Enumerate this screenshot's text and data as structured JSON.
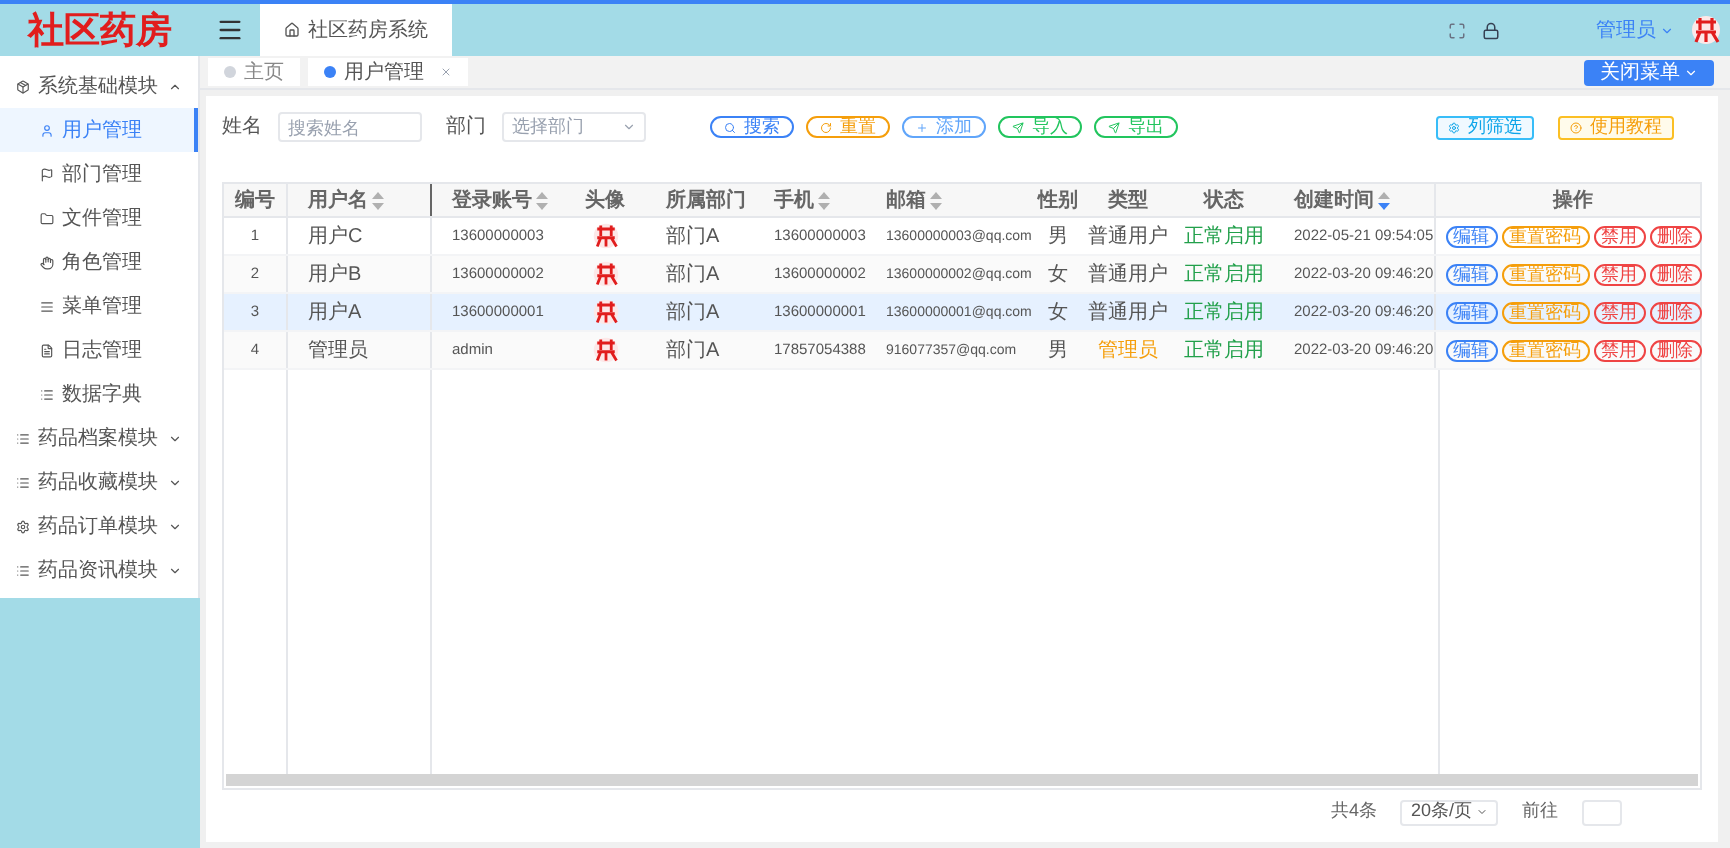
{
  "logo": "社区药房",
  "breadcrumb": "社区药房系统",
  "user": {
    "name": "管理员"
  },
  "tabs": [
    {
      "label": "主页",
      "selected": false,
      "closable": false
    },
    {
      "label": "用户管理",
      "selected": true,
      "closable": true
    }
  ],
  "close_menu": "关闭菜单",
  "sidebar": {
    "items": [
      {
        "label": "系统基础模块",
        "expanded": true,
        "children": [
          {
            "label": "用户管理",
            "selected": true
          },
          {
            "label": "部门管理",
            "selected": false
          },
          {
            "label": "文件管理",
            "selected": false
          },
          {
            "label": "角色管理",
            "selected": false
          },
          {
            "label": "菜单管理",
            "selected": false
          },
          {
            "label": "日志管理",
            "selected": false
          },
          {
            "label": "数据字典",
            "selected": false
          }
        ]
      },
      {
        "label": "药品档案模块",
        "expanded": false
      },
      {
        "label": "药品收藏模块",
        "expanded": false
      },
      {
        "label": "药品订单模块",
        "expanded": false
      },
      {
        "label": "药品资讯模块",
        "expanded": false
      }
    ]
  },
  "filters": [
    {
      "label": "姓名",
      "placeholder": "搜索姓名",
      "kind": "text"
    },
    {
      "label": "部门",
      "placeholder": "选择部门",
      "kind": "select"
    }
  ],
  "toolbar": [
    {
      "label": "搜索",
      "kind": "search"
    },
    {
      "label": "重置",
      "kind": "reset"
    },
    {
      "label": "添加",
      "kind": "add"
    },
    {
      "label": "导入",
      "kind": "import"
    },
    {
      "label": "导出",
      "kind": "export"
    }
  ],
  "tools": [
    {
      "label": "列筛选",
      "kind": "columns"
    },
    {
      "label": "使用教程",
      "kind": "help"
    }
  ],
  "table": {
    "columns": [
      {
        "label": "编号",
        "sortable": false,
        "sorted": false
      },
      {
        "label": "用户名",
        "sortable": true,
        "sorted": false
      },
      {
        "label": "登录账号",
        "sortable": true,
        "sorted": false
      },
      {
        "label": "头像",
        "sortable": false,
        "sorted": false
      },
      {
        "label": "所属部门",
        "sortable": false,
        "sorted": false
      },
      {
        "label": "手机",
        "sortable": true,
        "sorted": false
      },
      {
        "label": "邮箱",
        "sortable": true,
        "sorted": false
      },
      {
        "label": "性别",
        "sortable": false,
        "sorted": false
      },
      {
        "label": "类型",
        "sortable": false,
        "sorted": false
      },
      {
        "label": "状态",
        "sortable": false,
        "sorted": false
      },
      {
        "label": "创建时间",
        "sortable": true,
        "sorted": true
      },
      {
        "label": "操作",
        "sortable": false,
        "sorted": false
      }
    ],
    "rows": [
      {
        "id": "1",
        "name": "用户C",
        "account": "13600000003",
        "dept": "部门A",
        "phone": "13600000003",
        "email": "13600000003@qq.com",
        "gender": "男",
        "type": "普通用户",
        "kind": "normal",
        "status": "正常启用",
        "created": "2022-05-21 09:54:05",
        "selected": false,
        "actions": [
          {
            "label": "编辑",
            "kind": "edit"
          },
          {
            "label": "重置密码",
            "kind": "reset"
          },
          {
            "label": "禁用",
            "kind": "danger"
          },
          {
            "label": "删除",
            "kind": "danger"
          }
        ]
      },
      {
        "id": "2",
        "name": "用户B",
        "account": "13600000002",
        "dept": "部门A",
        "phone": "13600000002",
        "email": "13600000002@qq.com",
        "gender": "女",
        "type": "普通用户",
        "kind": "normal",
        "status": "正常启用",
        "created": "2022-03-20 09:46:20",
        "selected": false,
        "actions": [
          {
            "label": "编辑",
            "kind": "edit"
          },
          {
            "label": "重置密码",
            "kind": "reset"
          },
          {
            "label": "禁用",
            "kind": "danger"
          },
          {
            "label": "删除",
            "kind": "danger"
          }
        ]
      },
      {
        "id": "3",
        "name": "用户A",
        "account": "13600000001",
        "dept": "部门A",
        "phone": "13600000001",
        "email": "13600000001@qq.com",
        "gender": "女",
        "type": "普通用户",
        "kind": "normal",
        "status": "正常启用",
        "created": "2022-03-20 09:46:20",
        "selected": true,
        "actions": [
          {
            "label": "编辑",
            "kind": "edit"
          },
          {
            "label": "重置密码",
            "kind": "reset"
          },
          {
            "label": "禁用",
            "kind": "danger"
          },
          {
            "label": "删除",
            "kind": "danger"
          }
        ]
      },
      {
        "id": "4",
        "name": "管理员",
        "account": "admin",
        "dept": "部门A",
        "phone": "17857054388",
        "email": "916077357@qq.com",
        "gender": "男",
        "type": "管理员",
        "kind": "admin",
        "status": "正常启用",
        "created": "2022-03-20 09:46:20",
        "selected": false,
        "actions": [
          {
            "label": "编辑",
            "kind": "edit"
          },
          {
            "label": "重置密码",
            "kind": "reset"
          },
          {
            "label": "禁用",
            "kind": "danger"
          },
          {
            "label": "删除",
            "kind": "danger"
          }
        ]
      }
    ]
  },
  "pagination": {
    "total": "共4条",
    "page_size": "20条/页",
    "goto": "前往"
  }
}
